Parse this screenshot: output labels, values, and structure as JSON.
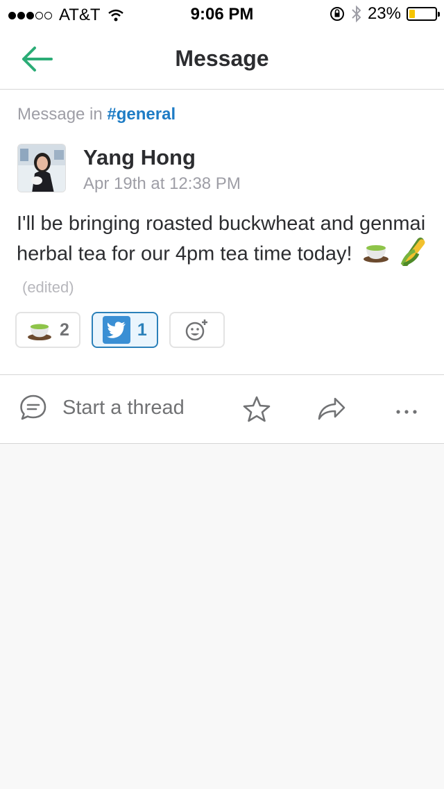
{
  "status_bar": {
    "carrier": "AT&T",
    "time": "9:06 PM",
    "battery": "23%",
    "battery_level": 0.23,
    "signal_bars": 3
  },
  "nav": {
    "title": "Message",
    "back_icon": "arrow-left-icon"
  },
  "message": {
    "context_prefix": "Message in",
    "channel": "#general",
    "author": "Yang Hong",
    "timestamp": "Apr 19th at 12:38 PM",
    "text": "I'll be bringing roasted buckwheat and genmai herbal tea for our 4pm tea time today!",
    "emojis": [
      "tea-icon",
      "corn-icon"
    ],
    "edited_label": "(edited)"
  },
  "reactions": [
    {
      "icon": "tea-icon",
      "count": "2",
      "active": false
    },
    {
      "icon": "twitter-icon",
      "count": "1",
      "active": true
    }
  ],
  "actions": {
    "thread_label": "Start a thread",
    "icons": [
      "comment-icon",
      "star-icon",
      "share-icon",
      "more-icon"
    ]
  },
  "colors": {
    "accent_green": "#2bac76",
    "link_blue": "#1e7cc5",
    "active_reaction": "#2a80b9"
  }
}
